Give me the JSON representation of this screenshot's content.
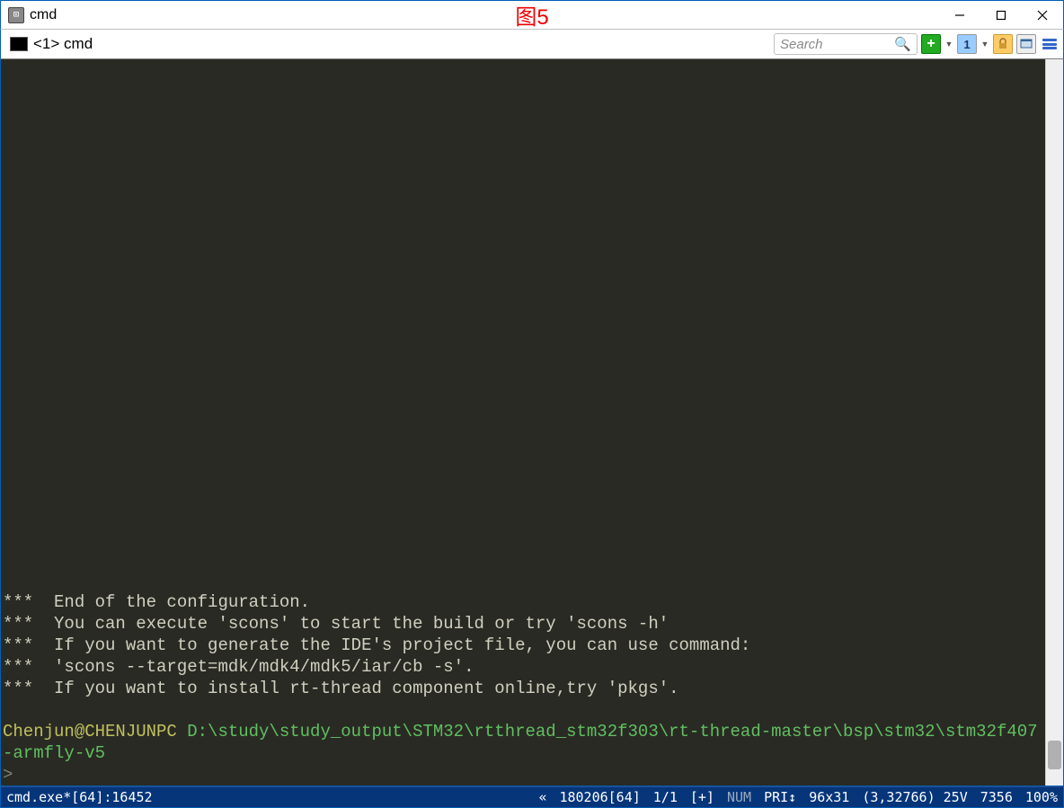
{
  "window": {
    "title": "cmd",
    "overlay_label": "图5"
  },
  "tab": {
    "label": "<1> cmd"
  },
  "toolbar": {
    "search_placeholder": "Search",
    "num_button": "1"
  },
  "terminal": {
    "lines": [
      "***  End of the configuration.",
      "***  You can execute 'scons' to start the build or try 'scons -h'",
      "***  If you want to generate the IDE's project file, you can use command:",
      "***  'scons --target=mdk/mdk4/mdk5/iar/cb -s'.",
      "***  If you want to install rt-thread component online,try 'pkgs'."
    ],
    "prompt_user": "Chenjun@CHENJUNPC ",
    "prompt_path": "D:\\study\\study_output\\STM32\\rtthread_stm32f303\\rt-thread-master\\bsp\\stm32\\stm32f407-armfly-v5",
    "prompt_caret": ">"
  },
  "status": {
    "process": "cmd.exe*[64]:16452",
    "chevrons": "«",
    "buf": "180206[64]",
    "pos": "1/1",
    "plus": "[+]",
    "num": "NUM",
    "pri": "PRI↕",
    "size": "96x31",
    "cursor": "(3,32766) 25V",
    "mem": "7356",
    "zoom": "100%"
  }
}
